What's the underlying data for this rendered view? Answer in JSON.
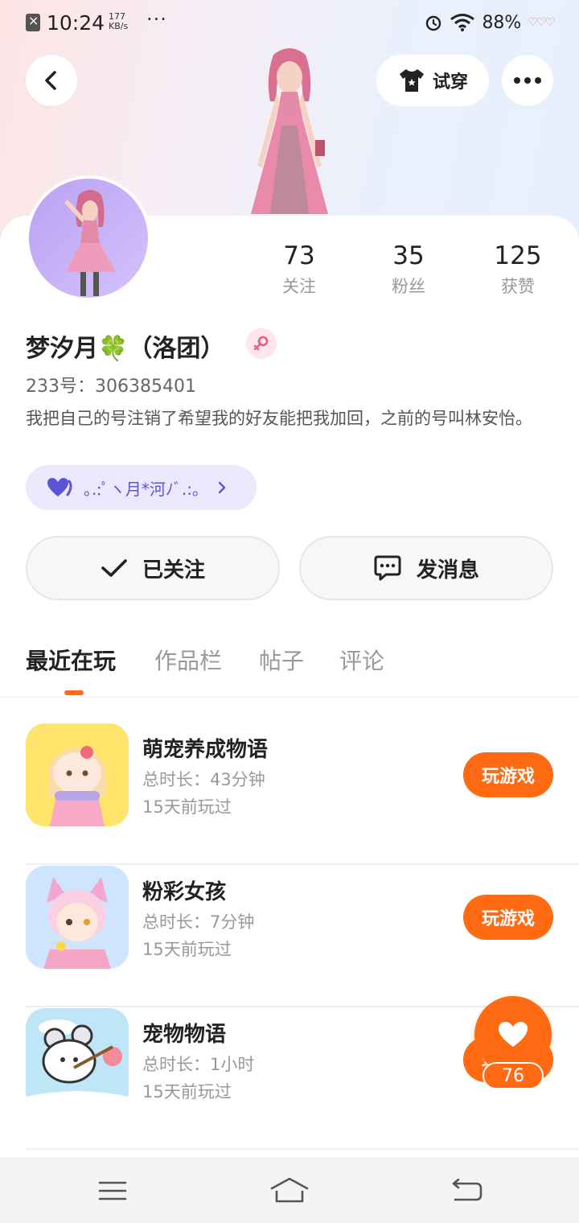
{
  "status_bar": {
    "time": "10:24",
    "speed_value": "177",
    "speed_unit": "KB/s",
    "more": "···",
    "battery": "88%"
  },
  "header": {
    "try_on_label": "试穿"
  },
  "profile": {
    "stats": [
      {
        "value": "73",
        "label": "关注"
      },
      {
        "value": "35",
        "label": "粉丝"
      },
      {
        "value": "125",
        "label": "获赞"
      }
    ],
    "nickname": "梦汐月🍀（洛团）",
    "uid": "233号：306385401",
    "bio": "我把自己的号注销了希望我的好友能把我加回，之前的号叫林安怡。",
    "group": "｡.:ﾟヽ月*河ﾉﾞ.:｡"
  },
  "actions": {
    "follow_label": "已关注",
    "message_label": "发消息"
  },
  "tabs": [
    "最近在玩",
    "作品栏",
    "帖子",
    "评论"
  ],
  "games": [
    {
      "name": "萌宠养成物语",
      "duration": "总时长：43分钟",
      "last_played": "15天前玩过",
      "button": "玩游戏"
    },
    {
      "name": "粉彩女孩",
      "duration": "总时长：7分钟",
      "last_played": "15天前玩过",
      "button": "玩游戏"
    },
    {
      "name": "宠物物语",
      "duration": "总时长：1小时",
      "last_played": "15天前玩过",
      "button": "玩游戏"
    }
  ],
  "like": {
    "count": "76"
  },
  "colors": {
    "accent": "#ff6a12",
    "group_bg": "#ece9ff",
    "group_text": "#5a55d6"
  },
  "icons": {
    "back": "chevron-left-icon",
    "shirt": "shirt-icon",
    "more": "more-dots-icon",
    "check": "check-icon",
    "chat": "chat-bubble-icon",
    "heart": "heart-icon",
    "gender": "female-icon",
    "nav_menu": "menu-icon",
    "nav_home": "home-icon",
    "nav_back": "back-icon"
  }
}
